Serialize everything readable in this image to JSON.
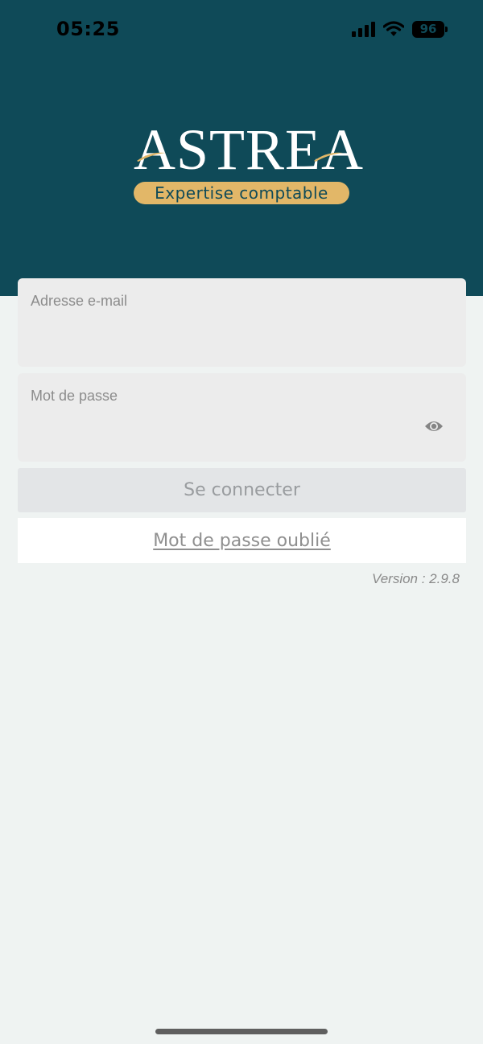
{
  "status_bar": {
    "time": "05:25",
    "battery": "96",
    "icons": [
      "signal-icon",
      "wifi-icon",
      "battery-icon"
    ]
  },
  "logo": {
    "word": "ASTREA",
    "tagline": "Expertise comptable"
  },
  "form": {
    "email_label": "Adresse e-mail",
    "email_value": "",
    "password_label": "Mot de passe",
    "password_value": "",
    "password_toggle_icon": "eye-icon",
    "login_label": "Se connecter",
    "forgot_label": "Mot de passe oublié"
  },
  "version": "Version : 2.9.8",
  "colors": {
    "header": "#0f4a58",
    "accent": "#e2b768",
    "background": "#eff3f2",
    "field": "#ececec",
    "button": "#e3e5e7"
  }
}
